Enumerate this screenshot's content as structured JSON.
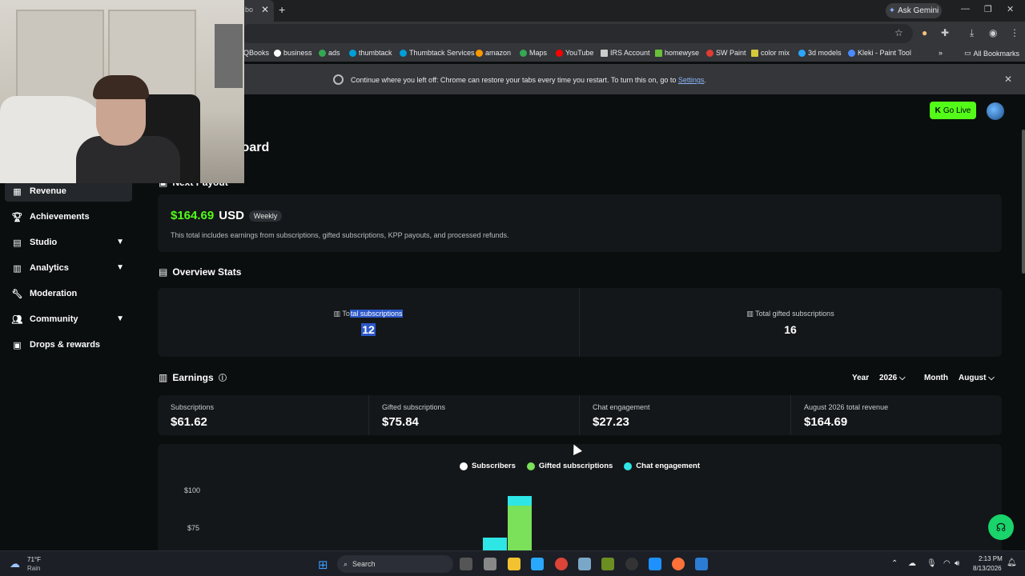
{
  "browser": {
    "tab_partial_label": "bo",
    "ask_gemini": "Ask Gemini",
    "bookmarks": [
      "QBooks",
      "business",
      "ads",
      "thumbtack",
      "Thumbtack Services",
      "amazon",
      "Maps",
      "YouTube",
      "IRS Account",
      "homewyse",
      "SW Paint",
      "color mix",
      "3d models",
      "Kleki - Paint Tool"
    ],
    "all_bookmarks": "All Bookmarks",
    "infobar": {
      "message": "Continue where you left off: Chrome can restore your tabs every time you restart. To turn this on, go to ",
      "link": "Settings",
      "suffix": "."
    }
  },
  "header": {
    "go_live": "Go Live",
    "page_title_partial": "nboard"
  },
  "sidebar": {
    "items": [
      {
        "label": "Revenue",
        "icon": "chart-icon"
      },
      {
        "label": "Achievements",
        "icon": "trophy-icon"
      },
      {
        "label": "Studio",
        "icon": "studio-icon"
      },
      {
        "label": "Analytics",
        "icon": "analytics-icon"
      },
      {
        "label": "Moderation",
        "icon": "wrench-icon"
      },
      {
        "label": "Community",
        "icon": "people-icon"
      },
      {
        "label": "Drops & rewards",
        "icon": "gift-icon"
      }
    ]
  },
  "payout": {
    "title": "Next Payout",
    "amount": "$164.69",
    "currency": "USD",
    "frequency": "Weekly",
    "description": "This total includes earnings from subscriptions, gifted subscriptions, KPP payouts, and processed refunds."
  },
  "overview": {
    "title": "Overview Stats",
    "stats": [
      {
        "label_a": "To",
        "label_b": "tal subscriptions",
        "value": "12"
      },
      {
        "label": "Total gifted subscriptions",
        "value": "16"
      }
    ]
  },
  "earnings": {
    "title": "Earnings",
    "year_label": "Year",
    "year_value": "2026",
    "month_label": "Month",
    "month_value": "August",
    "cells": [
      {
        "label": "Subscriptions",
        "value": "$61.62"
      },
      {
        "label": "Gifted subscriptions",
        "value": "$75.84"
      },
      {
        "label": "Chat engagement",
        "value": "$27.23"
      },
      {
        "label": "August 2026 total revenue",
        "value": "$164.69"
      }
    ]
  },
  "chart": {
    "legend": [
      {
        "name": "Subscribers",
        "color": "#ffffff"
      },
      {
        "name": "Gifted subscriptions",
        "color": "#7be05a"
      },
      {
        "name": "Chat engagement",
        "color": "#2ee6e6"
      }
    ],
    "y_ticks": [
      "$100",
      "$75"
    ]
  },
  "taskbar": {
    "weather_temp": "71°F",
    "weather_desc": "Rain",
    "search": "Search",
    "time": "2:13 PM",
    "date": "8/13/2026"
  },
  "colors": {
    "accent": "#53fc18",
    "bg": "#0b0e0f",
    "card": "#141719"
  }
}
